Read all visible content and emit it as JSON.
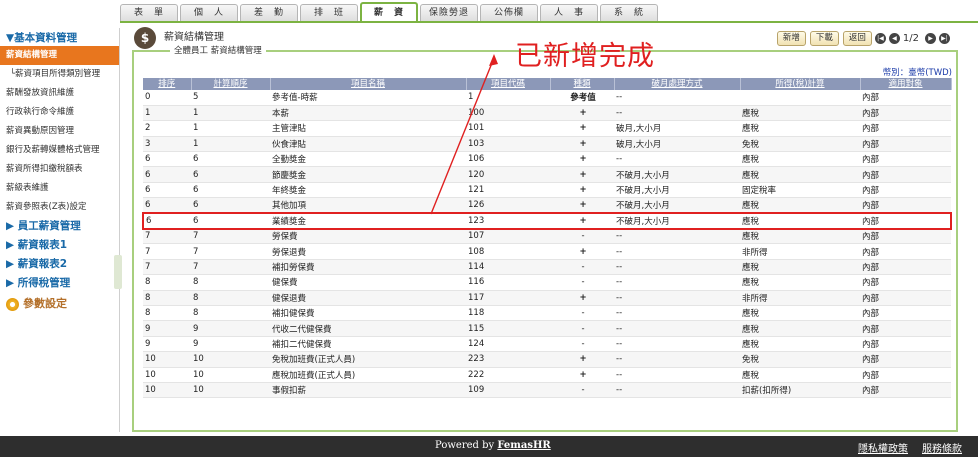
{
  "tabs": [
    {
      "label": "表　單",
      "active": false
    },
    {
      "label": "個　人",
      "active": false
    },
    {
      "label": "差　勤",
      "active": false
    },
    {
      "label": "排　班",
      "active": false
    },
    {
      "label": "薪　資",
      "active": true
    },
    {
      "label": "保險勞退",
      "active": false
    },
    {
      "label": "公佈欄",
      "active": false
    },
    {
      "label": "人　事",
      "active": false
    },
    {
      "label": "系　統",
      "active": false
    }
  ],
  "sidebar": {
    "section_title": "▼基本資料管理",
    "items": [
      {
        "label": "薪資結構管理",
        "active": true
      },
      {
        "label": "└薪資項目所得類別管理",
        "active": false
      },
      {
        "label": "薪酬發放資訊維護",
        "active": false
      },
      {
        "label": "行政執行命令維護",
        "active": false
      },
      {
        "label": "薪資異動原因管理",
        "active": false
      },
      {
        "label": "銀行及薪轉媒體格式管理",
        "active": false
      },
      {
        "label": "薪資所得扣繳稅額表",
        "active": false
      },
      {
        "label": "薪級表維護",
        "active": false
      },
      {
        "label": "薪資參照表(Z表)設定",
        "active": false
      }
    ],
    "groups": [
      "▶ 員工薪資管理",
      "▶ 薪資報表1",
      "▶ 薪資報表2",
      "▶ 所得稅管理"
    ],
    "param_label": "參數設定"
  },
  "page": {
    "title": "薪資結構管理",
    "panel_label": "全體員工 薪資結構管理",
    "annotation": "已新增完成",
    "currency": "幣別：臺幣(TWD)",
    "buttons": {
      "add": "新增",
      "download": "下載",
      "back": "返回"
    },
    "pagination": {
      "first": "|◀",
      "prev": "◀",
      "text": "1/2",
      "next": "▶",
      "last": "▶|"
    }
  },
  "table": {
    "headers": [
      "排序",
      "計算順序",
      "項目名稱",
      "項目代碼",
      "種類",
      "破月處理方式",
      "所得(稅)計算",
      "適用對象"
    ],
    "rows": [
      [
        "0",
        "5",
        "參考值-時薪",
        "1",
        "參考值",
        "--",
        "",
        "內部"
      ],
      [
        "1",
        "1",
        "本薪",
        "100",
        "+",
        "--",
        "應稅",
        "內部"
      ],
      [
        "2",
        "1",
        "主管津貼",
        "101",
        "+",
        "破月,大小月",
        "應稅",
        "內部"
      ],
      [
        "3",
        "1",
        "伙食津貼",
        "103",
        "+",
        "破月,大小月",
        "免稅",
        "內部"
      ],
      [
        "6",
        "6",
        "全勤獎金",
        "106",
        "+",
        "--",
        "應稅",
        "內部"
      ],
      [
        "6",
        "6",
        "節慶獎金",
        "120",
        "+",
        "不破月,大小月",
        "應稅",
        "內部"
      ],
      [
        "6",
        "6",
        "年終獎金",
        "121",
        "+",
        "不破月,大小月",
        "固定稅率",
        "內部"
      ],
      [
        "6",
        "6",
        "其他加項",
        "126",
        "+",
        "不破月,大小月",
        "應稅",
        "內部"
      ],
      [
        "6",
        "6",
        "業績獎金",
        "123",
        "+",
        "不破月,大小月",
        "應稅",
        "內部"
      ],
      [
        "7",
        "7",
        "勞保費",
        "107",
        "-",
        "--",
        "應稅",
        "內部"
      ],
      [
        "7",
        "7",
        "勞保退費",
        "108",
        "+",
        "--",
        "非所得",
        "內部"
      ],
      [
        "7",
        "7",
        "補扣勞保費",
        "114",
        "-",
        "--",
        "應稅",
        "內部"
      ],
      [
        "8",
        "8",
        "健保費",
        "116",
        "-",
        "--",
        "應稅",
        "內部"
      ],
      [
        "8",
        "8",
        "健保退費",
        "117",
        "+",
        "--",
        "非所得",
        "內部"
      ],
      [
        "8",
        "8",
        "補扣健保費",
        "118",
        "-",
        "--",
        "應稅",
        "內部"
      ],
      [
        "9",
        "9",
        "代收二代健保費",
        "115",
        "-",
        "--",
        "應稅",
        "內部"
      ],
      [
        "9",
        "9",
        "補扣二代健保費",
        "124",
        "-",
        "--",
        "應稅",
        "內部"
      ],
      [
        "10",
        "10",
        "免稅加班費(正式人員)",
        "223",
        "+",
        "--",
        "免稅",
        "內部"
      ],
      [
        "10",
        "10",
        "應稅加班費(正式人員)",
        "222",
        "+",
        "--",
        "應稅",
        "內部"
      ],
      [
        "10",
        "10",
        "事假扣薪",
        "109",
        "-",
        "--",
        "扣薪(扣所得)",
        "內部"
      ]
    ],
    "highlight_row": 8
  },
  "footer": {
    "powered_prefix": "Powered by ",
    "powered_brand": "FemasHR",
    "links": [
      "隱私權政策",
      "服務條款"
    ]
  },
  "colors": {
    "accent": "#7cb342",
    "sidebar_active": "#e8761e",
    "annotation": "#e02020",
    "header_bg": "#8c98b8"
  }
}
